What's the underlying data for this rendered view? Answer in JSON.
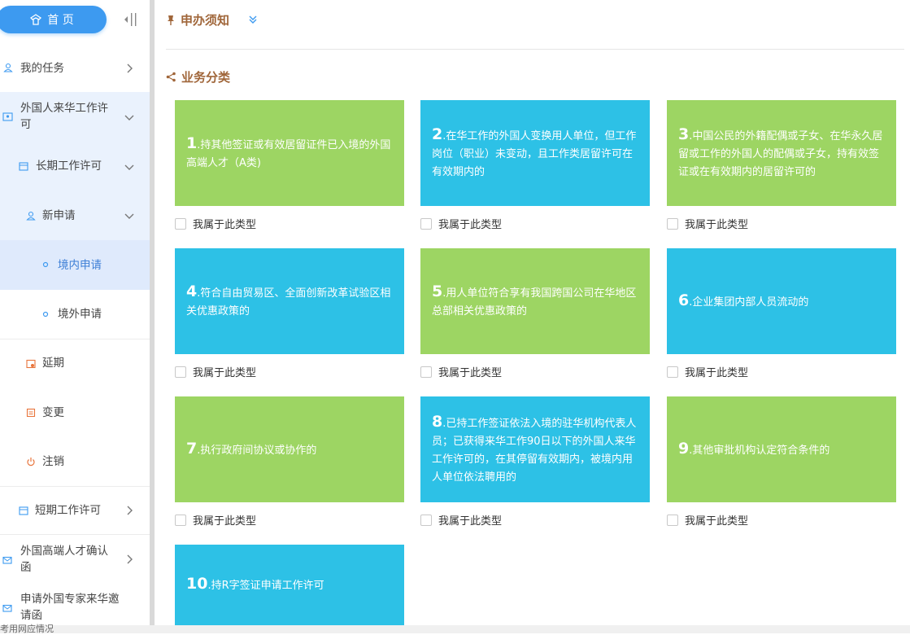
{
  "sidebar": {
    "home_label": "首 页",
    "items": [
      {
        "label": "我的任务"
      },
      {
        "label": "外国人来华工作许可"
      },
      {
        "label": "长期工作许可"
      },
      {
        "label": "新申请"
      },
      {
        "label": "境内申请"
      },
      {
        "label": "境外申请"
      },
      {
        "label": "延期"
      },
      {
        "label": "变更"
      },
      {
        "label": "注销"
      },
      {
        "label": "短期工作许可"
      },
      {
        "label": "外国高端人才确认函"
      },
      {
        "label": "申请外国专家来华邀请函"
      }
    ]
  },
  "main": {
    "notice_title": "申办须知",
    "category_title": "业务分类",
    "check_label": "我属于此类型",
    "cards": [
      {
        "num": "1",
        "text": ".持其他签证或有效居留证件已入境的外国高端人才（A类)",
        "color": "#9dd563"
      },
      {
        "num": "2",
        "text": ".在华工作的外国人变换用人单位，但工作岗位（职业）未变动，且工作类居留许可在有效期内的",
        "color": "#2dc1e6"
      },
      {
        "num": "3",
        "text": ".中国公民的外籍配偶或子女、在华永久居留或工作的外国人的配偶或子女，持有效签证或在有效期内的居留许可的",
        "color": "#9dd563"
      },
      {
        "num": "4",
        "text": ".符合自由贸易区、全面创新改革试验区相关优惠政策的",
        "color": "#2dc1e6"
      },
      {
        "num": "5",
        "text": ".用人单位符合享有我国跨国公司在华地区总部相关优惠政策的",
        "color": "#9dd563"
      },
      {
        "num": "6",
        "text": ".企业集团内部人员流动的",
        "color": "#2dc1e6"
      },
      {
        "num": "7",
        "text": ".执行政府间协议或协作的",
        "color": "#9dd563"
      },
      {
        "num": "8",
        "text": ".已持工作签证依法入境的驻华机构代表人员；已获得来华工作90日以下的外国人来华工作许可的，在其停留有效期内，被境内用人单位依法聘用的",
        "color": "#2dc1e6"
      },
      {
        "num": "9",
        "text": ".其他审批机构认定符合条件的",
        "color": "#9dd563"
      },
      {
        "num": "10",
        "text": ".持R字签证申请工作许可",
        "color": "#2dc1e6"
      }
    ]
  },
  "footer_text": "考用网应情况"
}
